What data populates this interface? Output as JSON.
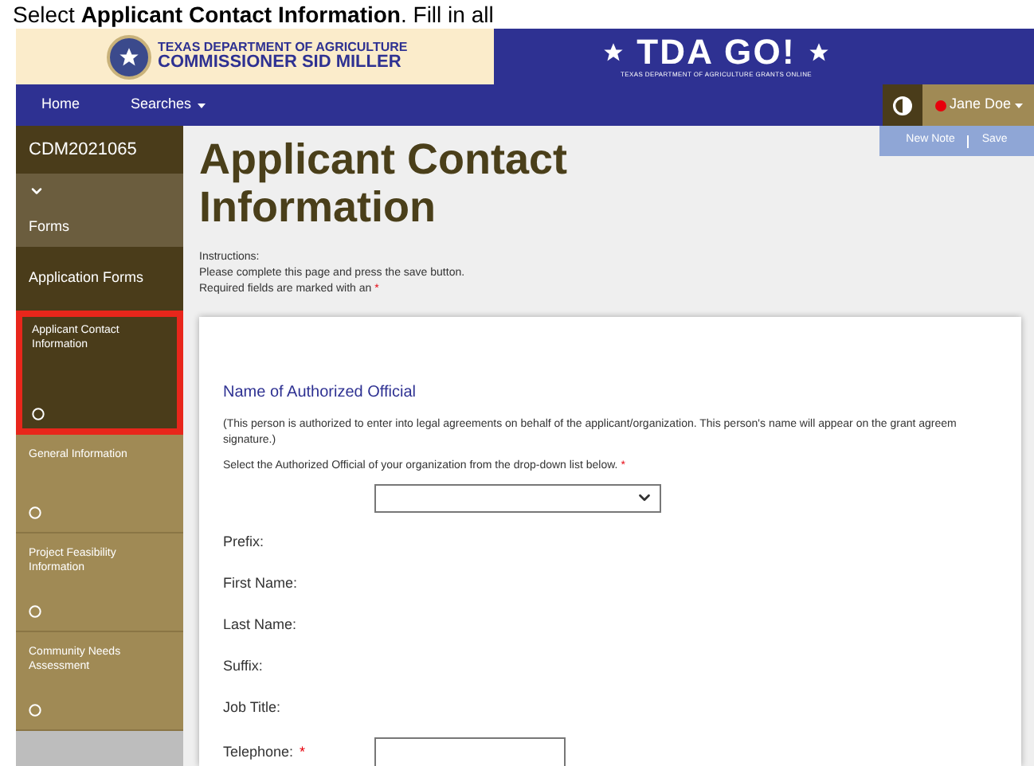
{
  "caption": "Select **Applicant Contact Information**. Fill in all",
  "banner": {
    "agency": "TEXAS DEPARTMENT OF AGRICULTURE",
    "commissioner": "COMMISSIONER SID MILLER",
    "product": "TDA GO!",
    "tagline": "TEXAS DEPARTMENT OF AGRICULTURE GRANTS ONLINE"
  },
  "nav": {
    "items": [
      {
        "label": "Home",
        "dropdown": false
      },
      {
        "label": "Searches",
        "dropdown": true
      }
    ],
    "user": "Jane Doe",
    "actions": [
      "New Note",
      "Save"
    ]
  },
  "sidebar": {
    "id": "CDM2021065",
    "section": "Forms",
    "group": "Application Forms",
    "items": [
      {
        "label": "Applicant Contact Information",
        "selected": true
      },
      {
        "label": "General Information",
        "selected": false
      },
      {
        "label": "Project Feasibility Information",
        "selected": false
      },
      {
        "label": "Community Needs Assessment",
        "selected": false
      }
    ]
  },
  "page": {
    "title": "Applicant Contact Information",
    "instructions": [
      "Instructions:",
      "Please complete this page and press the save button."
    ],
    "required_note": "Required fields are marked with an",
    "required_mark": "*"
  },
  "form": {
    "heading": "Name of Authorized Official",
    "description": [
      "(This person is authorized to enter into legal agreements on behalf of the applicant/organization. This person's name will appear on the grant agreem",
      "signature.)"
    ],
    "prompt": "Select the Authorized Official of your organization from the drop-down list below.",
    "prompt_mark": "*",
    "fields": [
      {
        "kind": "select"
      },
      {
        "kind": "text",
        "label": "Prefix:"
      },
      {
        "kind": "text",
        "label": "First Name:"
      },
      {
        "kind": "text",
        "label": "Last Name:"
      },
      {
        "kind": "text",
        "label": "Suffix:"
      },
      {
        "kind": "text",
        "label": "Job Title:"
      },
      {
        "kind": "input",
        "label": "Telephone:",
        "required_mark": "*"
      }
    ]
  }
}
